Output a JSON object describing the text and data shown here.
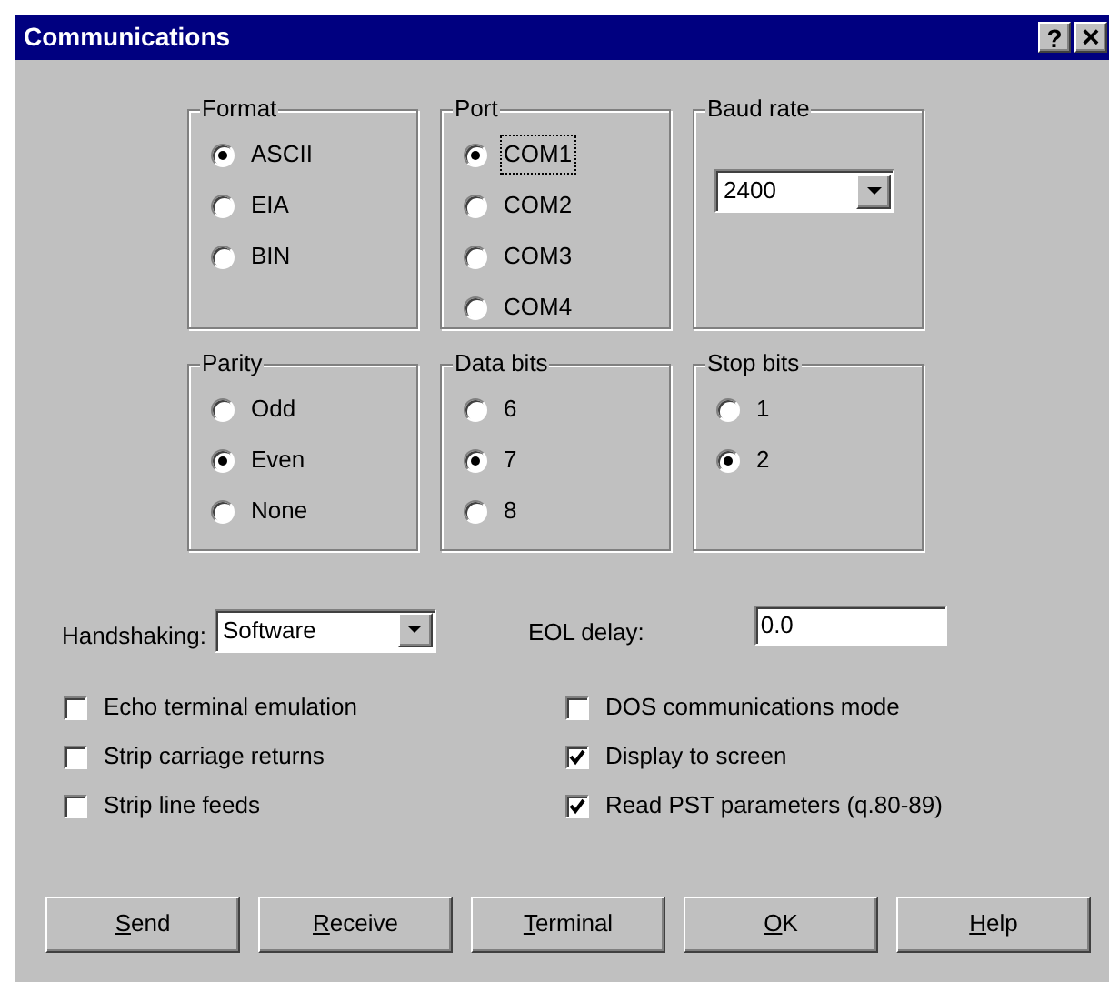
{
  "window": {
    "title": "Communications",
    "controls": [
      {
        "kind": "help",
        "label": "?"
      },
      {
        "kind": "close",
        "label": "×"
      }
    ]
  },
  "groups": [
    {
      "title": "Format",
      "kind": "radios",
      "options": [
        {
          "label": "ASCII",
          "selected": true,
          "focused": false
        },
        {
          "label": "EIA",
          "selected": false,
          "focused": false
        },
        {
          "label": "BIN",
          "selected": false,
          "focused": false
        }
      ]
    },
    {
      "title": "Port",
      "kind": "radios",
      "options": [
        {
          "label": "COM1",
          "selected": true,
          "focused": true
        },
        {
          "label": "COM2",
          "selected": false,
          "focused": false
        },
        {
          "label": "COM3",
          "selected": false,
          "focused": false
        },
        {
          "label": "COM4",
          "selected": false,
          "focused": false
        }
      ]
    },
    {
      "title": "Baud rate",
      "kind": "dropdown",
      "value": "2400"
    },
    {
      "title": "Parity",
      "kind": "radios",
      "options": [
        {
          "label": "Odd",
          "selected": false,
          "focused": false
        },
        {
          "label": "Even",
          "selected": true,
          "focused": false
        },
        {
          "label": "None",
          "selected": false,
          "focused": false
        }
      ]
    },
    {
      "title": "Data bits",
      "kind": "radios",
      "options": [
        {
          "label": "6",
          "selected": false,
          "focused": false
        },
        {
          "label": "7",
          "selected": true,
          "focused": false
        },
        {
          "label": "8",
          "selected": false,
          "focused": false
        }
      ]
    },
    {
      "title": "Stop bits",
      "kind": "radios",
      "options": [
        {
          "label": "1",
          "selected": false,
          "focused": false
        },
        {
          "label": "2",
          "selected": true,
          "focused": false
        }
      ]
    }
  ],
  "handshaking": {
    "label": "Handshaking:",
    "value": "Software"
  },
  "eol_delay": {
    "label": "EOL delay:",
    "value": "0.0"
  },
  "checkboxes_left": [
    {
      "label": "Echo terminal emulation",
      "checked": false
    },
    {
      "label": "Strip carriage returns",
      "checked": false
    },
    {
      "label": "Strip line feeds",
      "checked": false
    }
  ],
  "checkboxes_right": [
    {
      "label": "DOS communications mode",
      "checked": false
    },
    {
      "label": "Display to screen",
      "checked": true
    },
    {
      "label": "Read PST parameters (q.80-89)",
      "checked": true
    }
  ],
  "buttons": [
    {
      "mnemonic": "S",
      "rest": "end"
    },
    {
      "mnemonic": "R",
      "rest": "eceive"
    },
    {
      "mnemonic": "T",
      "rest": "erminal"
    },
    {
      "mnemonic": "O",
      "rest": "K"
    },
    {
      "mnemonic": "H",
      "rest": "elp"
    }
  ]
}
